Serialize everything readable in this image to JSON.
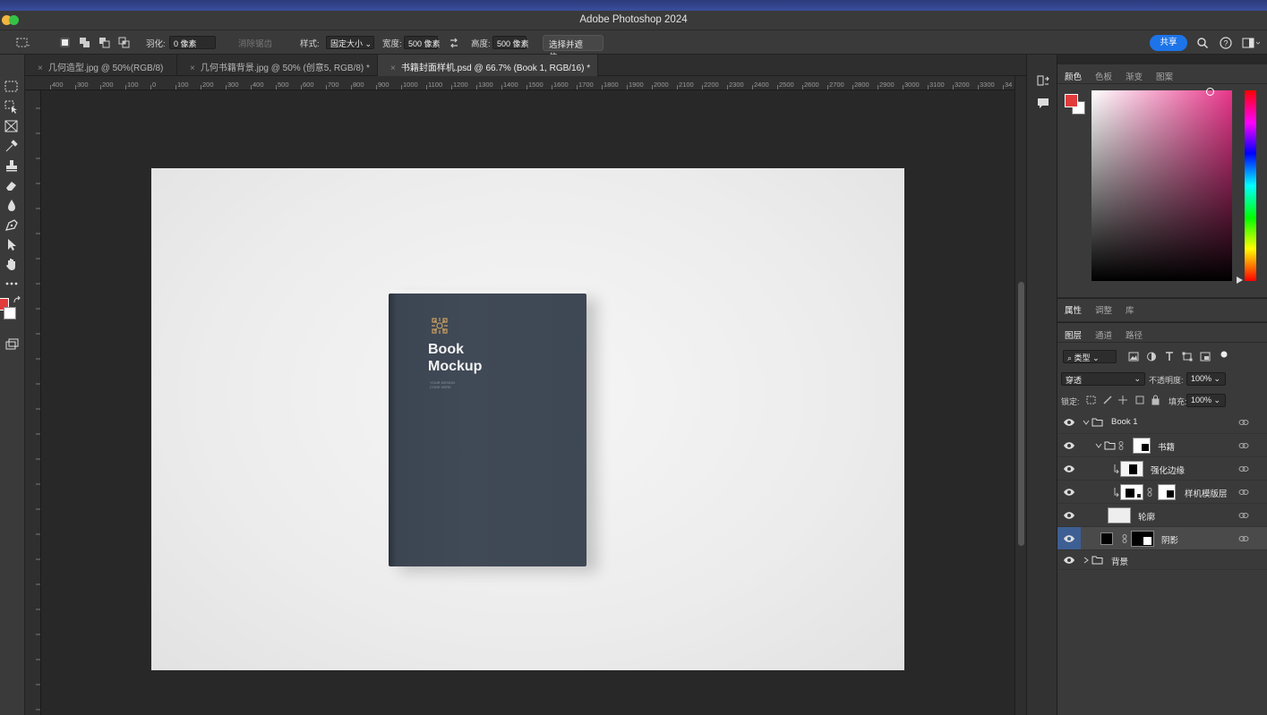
{
  "app": {
    "window_title": "Adobe Photoshop 2024"
  },
  "options_bar": {
    "feather_label": "羽化:",
    "feather_value": "0 像素",
    "antialias_label": "消除锯齿",
    "style_label": "样式:",
    "style_value": "固定大小",
    "width_label": "宽度:",
    "width_value": "500 像素",
    "height_label": "高度:",
    "height_value": "500 像素",
    "select_mask_button": "选择并遮住...",
    "share_button": "共享"
  },
  "document_tabs": [
    {
      "label": "几何造型.jpg @ 50%(RGB/8)",
      "active": false
    },
    {
      "label": "几何书籍背景.jpg @ 50% (创意5, RGB/8) *",
      "active": false
    },
    {
      "label": "书籍封面样机.psd @ 66.7% (Book 1, RGB/16) *",
      "active": true
    }
  ],
  "ruler_labels": [
    "400",
    "300",
    "200",
    "100",
    "0",
    "100",
    "200",
    "300",
    "400",
    "500",
    "600",
    "700",
    "800",
    "900",
    "1000",
    "1100",
    "1200",
    "1300",
    "1400",
    "1500",
    "1600",
    "1700",
    "1800",
    "1900",
    "2000",
    "2100",
    "2200",
    "2300",
    "2400",
    "2500",
    "2600",
    "2700",
    "2800",
    "2900",
    "3000",
    "3100",
    "3200",
    "3300",
    "34"
  ],
  "canvas": {
    "book_title_line1": "Book",
    "book_title_line2": "Mockup",
    "book_subtitle": "YOUR DESIGN CODE HERE"
  },
  "color_panel": {
    "tabs": [
      "颜色",
      "色板",
      "渐变",
      "图案"
    ],
    "foreground_color": "#e23b3b",
    "background_color": "#ffffff"
  },
  "properties_panel": {
    "tabs": [
      "属性",
      "调整",
      "库"
    ]
  },
  "layers_panel": {
    "tabs": [
      "图层",
      "通道",
      "路径"
    ],
    "filter_kind": "类型",
    "blend_mode": "穿透",
    "opacity_label": "不透明度:",
    "opacity_value": "100%",
    "lock_label": "锁定:",
    "fill_label": "填充:",
    "fill_value": "100%",
    "layers": [
      {
        "name": "Book 1",
        "type": "group",
        "expanded": true,
        "indent": 0,
        "selected": false
      },
      {
        "name": "书籍",
        "type": "group",
        "expanded": true,
        "indent": 1,
        "selected": false
      },
      {
        "name": "强化边缘",
        "type": "layer",
        "indent": 2,
        "selected": false
      },
      {
        "name": "样机模版层",
        "type": "smart",
        "indent": 2,
        "selected": false
      },
      {
        "name": "轮廓",
        "type": "layer",
        "indent": 2,
        "selected": false
      },
      {
        "name": "阴影",
        "type": "layer",
        "indent": 1,
        "selected": true
      },
      {
        "name": "背景",
        "type": "group",
        "expanded": false,
        "indent": 0,
        "selected": false
      }
    ]
  }
}
